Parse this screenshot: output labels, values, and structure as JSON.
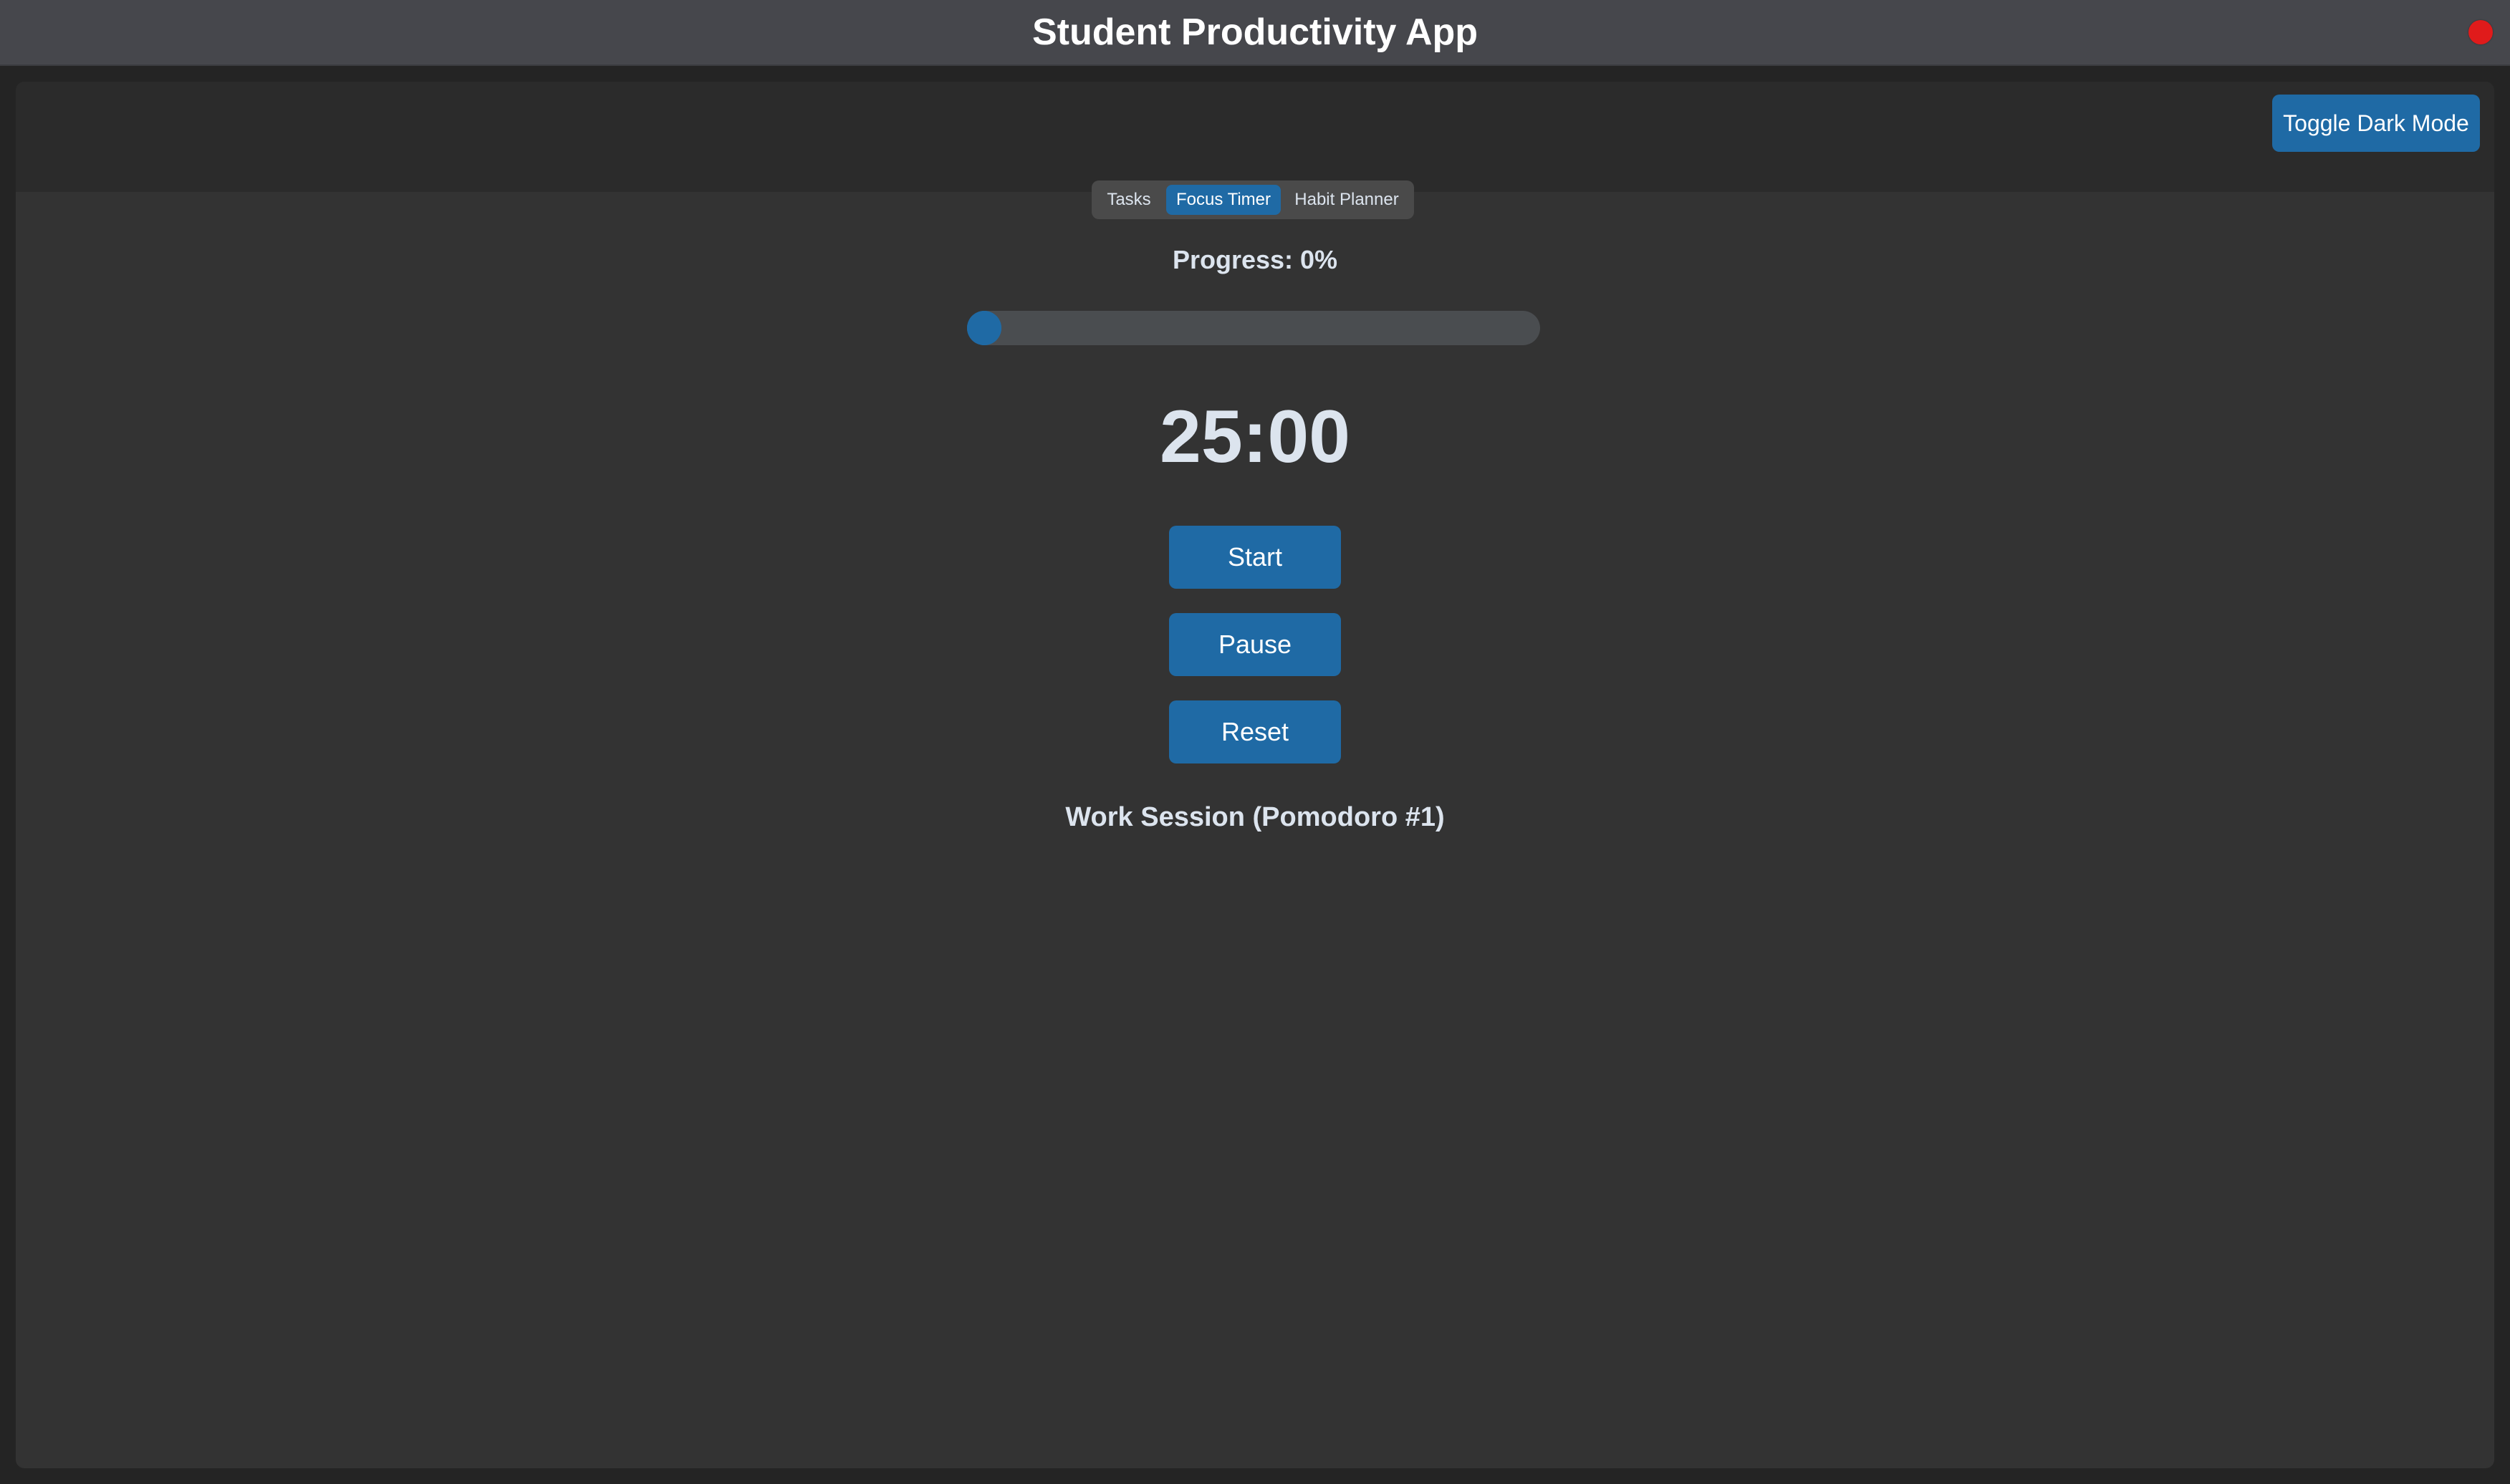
{
  "window": {
    "title": "Student Productivity App"
  },
  "header": {
    "toggle_dark_mode_label": "Toggle Dark Mode"
  },
  "tabs": [
    {
      "label": "Tasks",
      "active": false
    },
    {
      "label": "Focus Timer",
      "active": true
    },
    {
      "label": "Habit Planner",
      "active": false
    }
  ],
  "focus_timer": {
    "progress_label": "Progress: 0%",
    "progress_fraction": 0,
    "time_display": "25:00",
    "start_label": "Start",
    "pause_label": "Pause",
    "reset_label": "Reset",
    "session_label": "Work Session (Pomodoro #1)"
  },
  "colors": {
    "accent": "#1f6aa5",
    "titlebar": "#46474c",
    "close": "#e01b1b",
    "background": "#333333"
  },
  "icons": {
    "close": "close-dot-icon"
  }
}
